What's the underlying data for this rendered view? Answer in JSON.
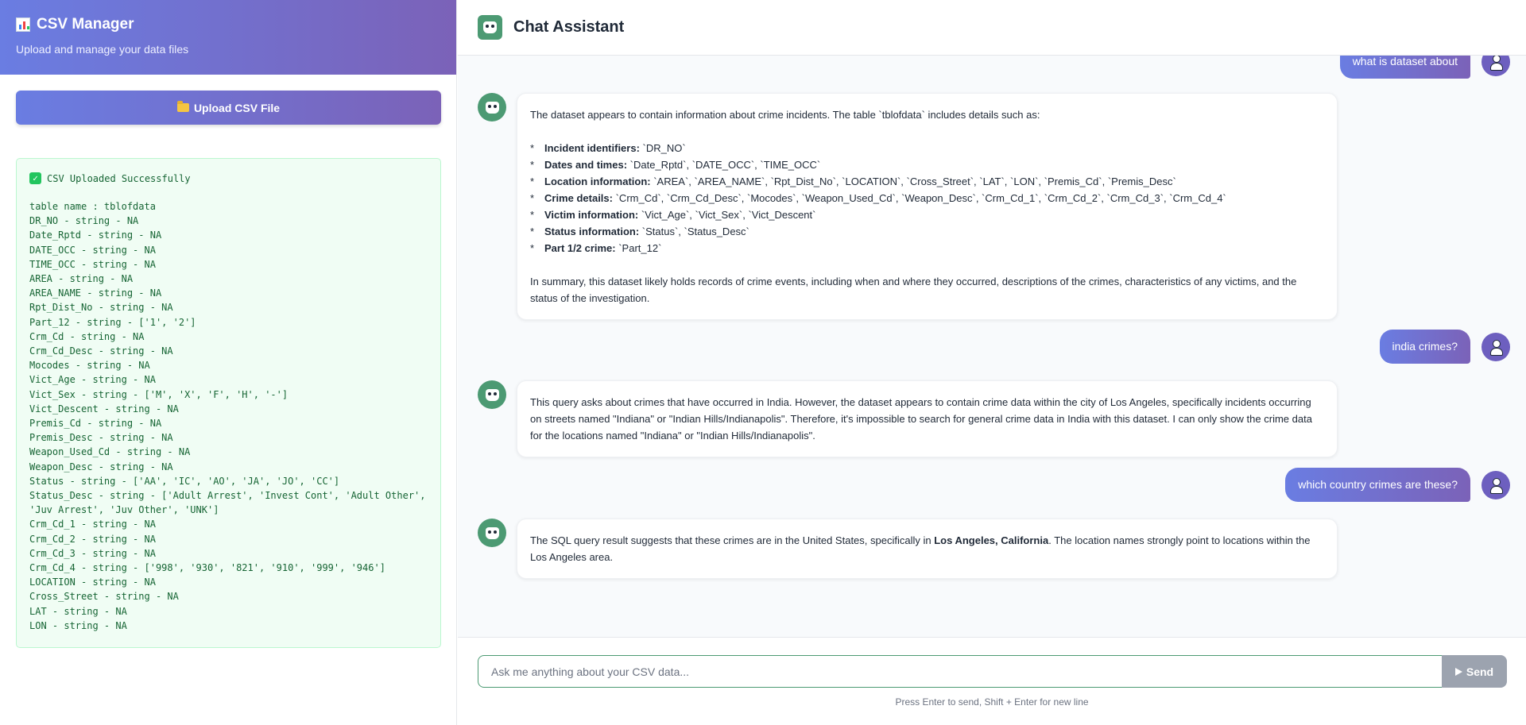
{
  "sidebar": {
    "title": "CSV Manager",
    "subtitle": "Upload and manage your data files",
    "upload_label": "Upload CSV File",
    "status": "CSV Uploaded Successfully",
    "schema_lines": [
      "table name : tblofdata",
      "DR_NO - string - NA",
      "Date_Rptd - string - NA",
      "DATE_OCC - string - NA",
      "TIME_OCC - string - NA",
      "AREA - string - NA",
      "AREA_NAME - string - NA",
      "Rpt_Dist_No - string - NA",
      "Part_12 - string - ['1', '2']",
      "Crm_Cd - string - NA",
      "Crm_Cd_Desc - string - NA",
      "Mocodes - string - NA",
      "Vict_Age - string - NA",
      "Vict_Sex - string - ['M', 'X', 'F', 'H', '-']",
      "Vict_Descent - string - NA",
      "Premis_Cd - string - NA",
      "Premis_Desc - string - NA",
      "Weapon_Used_Cd - string - NA",
      "Weapon_Desc - string - NA",
      "Status - string - ['AA', 'IC', 'AO', 'JA', 'JO', 'CC']",
      "Status_Desc - string - ['Adult Arrest', 'Invest Cont', 'Adult Other',",
      "'Juv Arrest', 'Juv Other', 'UNK']",
      "Crm_Cd_1 - string - NA",
      "Crm_Cd_2 - string - NA",
      "Crm_Cd_3 - string - NA",
      "Crm_Cd_4 - string - ['998', '930', '821', '910', '999', '946']",
      "LOCATION - string - NA",
      "Cross_Street - string - NA",
      "LAT - string - NA",
      "LON - string - NA"
    ]
  },
  "chat": {
    "title": "Chat Assistant",
    "messages": [
      {
        "role": "user",
        "text": "what is dataset about"
      },
      {
        "role": "assistant",
        "intro": "The dataset appears to contain information about crime incidents. The table `tblofdata` includes details such as:",
        "bullets": [
          {
            "label": "Incident identifiers:",
            "text": " `DR_NO`"
          },
          {
            "label": "Dates and times:",
            "text": " `Date_Rptd`, `DATE_OCC`, `TIME_OCC`"
          },
          {
            "label": "Location information:",
            "text": " `AREA`, `AREA_NAME`, `Rpt_Dist_No`, `LOCATION`, `Cross_Street`, `LAT`, `LON`, `Premis_Cd`, `Premis_Desc`"
          },
          {
            "label": "Crime details:",
            "text": " `Crm_Cd`, `Crm_Cd_Desc`, `Mocodes`, `Weapon_Used_Cd`, `Weapon_Desc`, `Crm_Cd_1`, `Crm_Cd_2`, `Crm_Cd_3`, `Crm_Cd_4`"
          },
          {
            "label": "Victim information:",
            "text": " `Vict_Age`, `Vict_Sex`, `Vict_Descent`"
          },
          {
            "label": "Status information:",
            "text": " `Status`, `Status_Desc`"
          },
          {
            "label": "Part 1/2 crime:",
            "text": " `Part_12`"
          }
        ],
        "summary": "In summary, this dataset likely holds records of crime events, including when and where they occurred, descriptions of the crimes, characteristics of any victims, and the status of the investigation."
      },
      {
        "role": "user",
        "text": "india crimes?"
      },
      {
        "role": "assistant",
        "text": "This query asks about crimes that have occurred in India. However, the dataset appears to contain crime data within the city of Los Angeles, specifically incidents occurring on streets named \"Indiana\" or \"Indian Hills/Indianapolis\". Therefore, it's impossible to search for general crime data in India with this dataset. I can only show the crime data for the locations named \"Indiana\" or \"Indian Hills/Indianapolis\"."
      },
      {
        "role": "user",
        "text": "which country crimes are these?"
      },
      {
        "role": "assistant",
        "pre": "The SQL query result suggests that these crimes are in the United States, specifically in ",
        "bold": "Los Angeles, California",
        "post": ". The location names strongly point to locations within the Los Angeles area."
      }
    ],
    "input_placeholder": "Ask me anything about your CSV data...",
    "send_label": "Send",
    "hint": "Press Enter to send, Shift + Enter for new line"
  },
  "colors": {
    "accent_start": "#6a7de2",
    "accent_end": "#7b62b8",
    "success_bg": "#f0fdf4",
    "success_text": "#166534",
    "bot_avatar": "#4c9a73",
    "send_disabled": "#9ca3af"
  },
  "icons": {
    "title_icon": "bar-chart-icon",
    "upload_icon": "folder-icon",
    "success_icon": "check-icon",
    "bot_icon": "bot-icon",
    "user_icon": "person-icon",
    "send_icon": "send-icon"
  }
}
